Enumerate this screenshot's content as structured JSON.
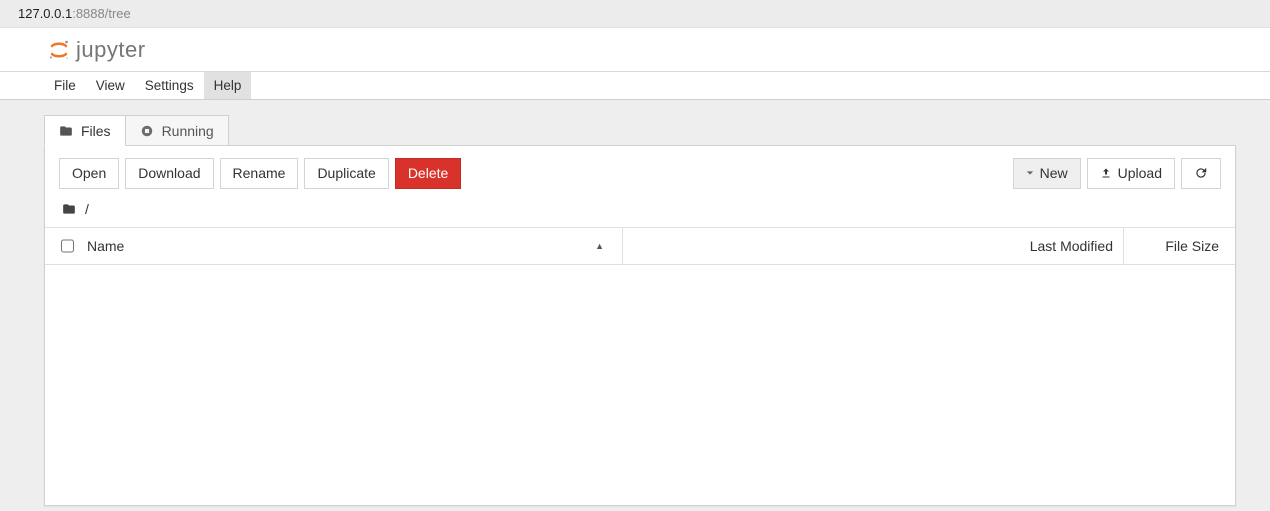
{
  "url": {
    "host": "127.0.0.1",
    "rest": ":8888/tree"
  },
  "brand": {
    "name": "jupyter"
  },
  "menu": {
    "items": [
      "File",
      "View",
      "Settings",
      "Help"
    ],
    "activeIndex": 3
  },
  "tabs": {
    "items": [
      {
        "label": "Files",
        "icon": "folder-icon"
      },
      {
        "label": "Running",
        "icon": "stop-circle-icon"
      }
    ],
    "activeIndex": 0
  },
  "toolbar": {
    "left": {
      "open": "Open",
      "download": "Download",
      "rename": "Rename",
      "duplicate": "Duplicate",
      "delete": "Delete"
    },
    "right": {
      "new": "New",
      "upload": "Upload"
    }
  },
  "breadcrumb": {
    "path": "/"
  },
  "columns": {
    "name": "Name",
    "modified": "Last Modified",
    "size": "File Size"
  }
}
